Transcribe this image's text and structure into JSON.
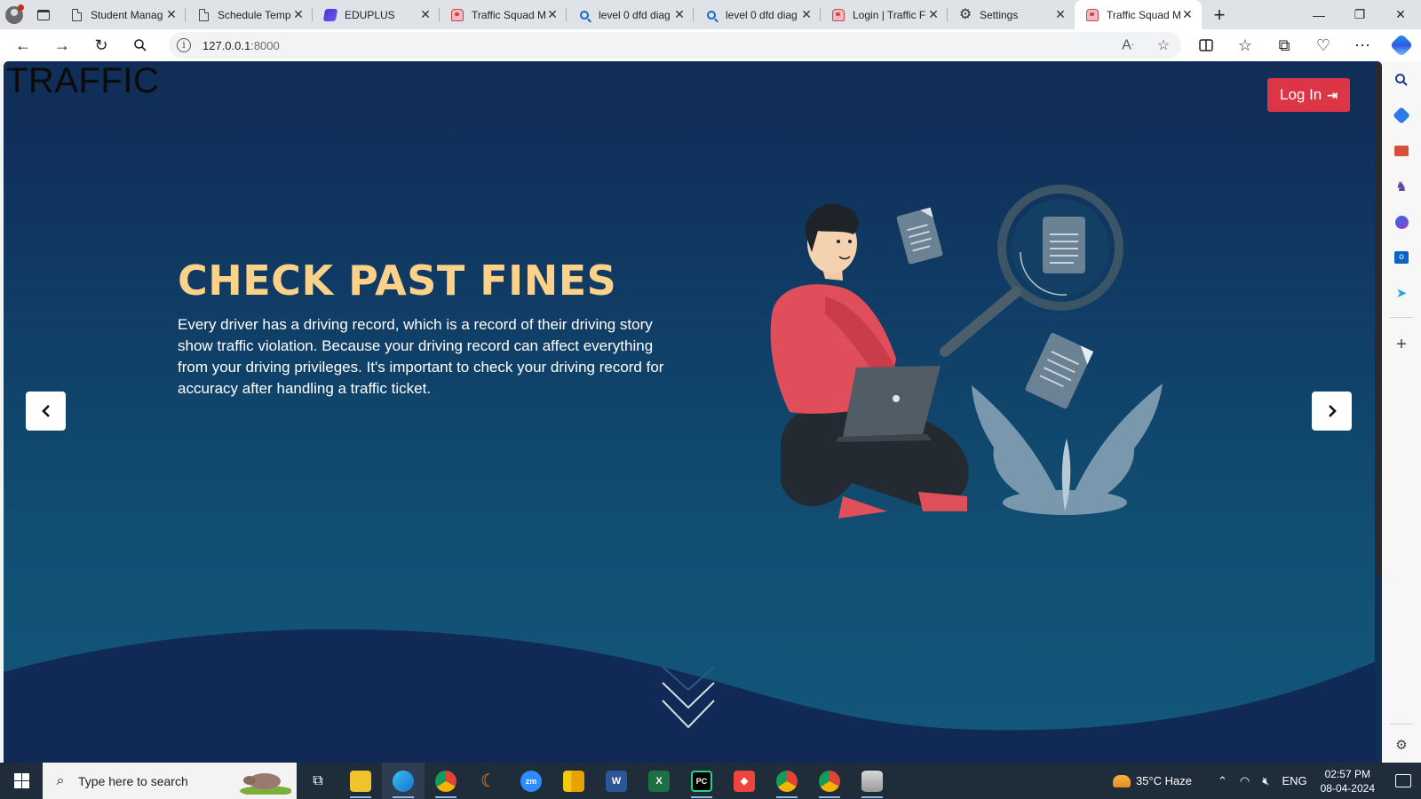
{
  "browser": {
    "tabs": [
      {
        "title": "Student Manag",
        "icon": "page-icon"
      },
      {
        "title": "Schedule Temp",
        "icon": "page-icon"
      },
      {
        "title": "EDUPLUS",
        "icon": "eduplus-icon"
      },
      {
        "title": "Traffic Squad M",
        "icon": "traffic-icon"
      },
      {
        "title": "level 0 dfd diag",
        "icon": "search-icon"
      },
      {
        "title": "level 0 dfd diag",
        "icon": "search-icon"
      },
      {
        "title": "Login | Traffic F",
        "icon": "traffic-icon"
      },
      {
        "title": "Settings",
        "icon": "gear-icon"
      },
      {
        "title": "Traffic Squad M",
        "icon": "traffic-icon",
        "active": true
      }
    ],
    "url_host": "127.0.0.1",
    "url_port": ":8000"
  },
  "page": {
    "brand": "TRAFFIC",
    "login_label": "Log In",
    "hero": {
      "title": "CHECK PAST FINES",
      "text": "Every driver has a driving record, which is a record of their driving story show traffic violation. Because your driving record can affect everything from your driving privileges. It's important to check your driving record for accuracy after handling a traffic ticket."
    },
    "colors": {
      "navbar": "#102e58",
      "hero_title": "#fcd189",
      "login_button": "#dc3545",
      "wave": "#102a55"
    }
  },
  "taskbar": {
    "search_placeholder": "Type here to search",
    "weather": "35°C  Haze",
    "language": "ENG",
    "time": "02:57 PM",
    "date": "08-04-2024"
  }
}
